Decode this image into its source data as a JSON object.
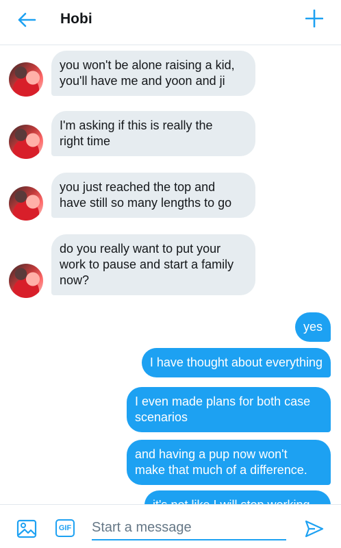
{
  "header": {
    "back_icon": "arrow-left-icon",
    "title": "Hobi",
    "add_icon": "plus-icon"
  },
  "colors": {
    "accent": "#1da1f2",
    "incoming_bubble": "#e6ecf0",
    "divider": "#e1e8ed"
  },
  "incoming": [
    {
      "lines": [
        "you won't be alone raising a kid,",
        "you'll have me and yoon and ji"
      ]
    },
    {
      "lines": [
        "I'm asking if this is really the",
        "right time"
      ]
    },
    {
      "lines": [
        "you just reached the top and",
        "have still so many lengths to go"
      ]
    },
    {
      "lines": [
        "do you really want to put your",
        "work to pause and start a family",
        "now?"
      ]
    }
  ],
  "outgoing": [
    {
      "lines": [
        "yes"
      ]
    },
    {
      "lines": [
        "I have thought about everything"
      ]
    },
    {
      "lines": [
        "I even made plans for both case",
        "scenarios"
      ]
    },
    {
      "lines": [
        "and having a pup now won't",
        "make that much of a difference."
      ]
    },
    {
      "lines": [
        "it's not like I will stop working"
      ]
    }
  ],
  "composer": {
    "media_icon": "image-icon",
    "gif_label": "GIF",
    "placeholder": "Start a message",
    "send_icon": "send-icon"
  }
}
